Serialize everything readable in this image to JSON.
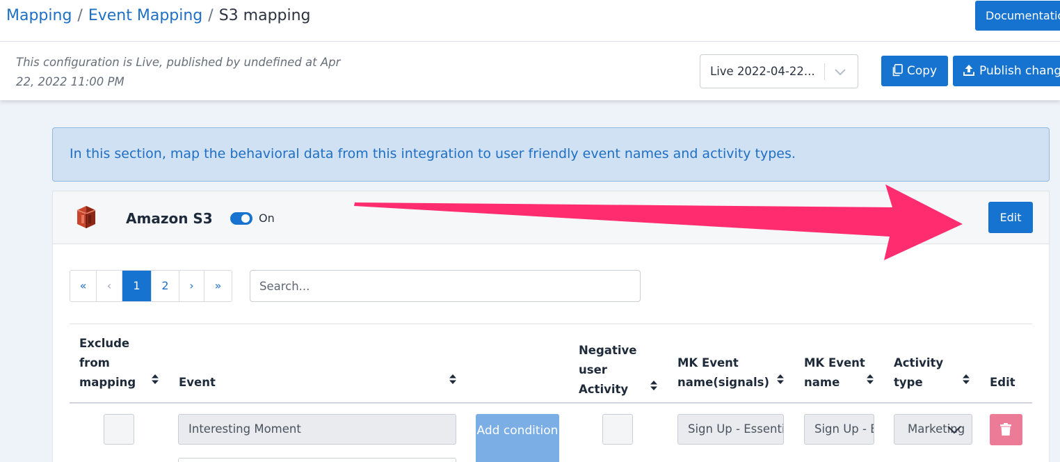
{
  "breadcrumb": {
    "items": [
      "Mapping",
      "Event Mapping"
    ],
    "separator": "/",
    "current": "S3 mapping"
  },
  "header": {
    "documentation_label": "Documentation"
  },
  "status": {
    "note": "This configuration is Live, published by undefined at Apr 22, 2022 11:00 PM",
    "version_selected": "Live 2022-04-22...",
    "copy_label": "Copy",
    "publish_label": "Publish changes"
  },
  "banner": {
    "text": "In this section, map the behavioral data from this integration to user friendly event names and activity types."
  },
  "integration": {
    "name": "Amazon S3",
    "toggle_on": true,
    "toggle_label": "On",
    "edit_label": "Edit"
  },
  "pagination": {
    "first": "«",
    "prev": "‹",
    "pages": [
      "1",
      "2"
    ],
    "active_page": "1",
    "next": "›",
    "last": "»"
  },
  "search": {
    "placeholder": "Search...",
    "value": ""
  },
  "table": {
    "headers": {
      "exclude": "Exclude from mapping",
      "event": "Event",
      "negative": "Negative user Activity",
      "mk_signals": "MK Event name(signals)",
      "mk_name": "MK Event name",
      "activity": "Activity type",
      "edit": "Edit"
    },
    "rows": [
      {
        "exclude_checked": false,
        "event": "Interesting Moment",
        "add_condition_label": "Add condition",
        "negative_checked": false,
        "mk_signals": "Sign Up - Essential",
        "mk_name": "Sign Up - Essential",
        "activity_type": "Marketing"
      }
    ]
  },
  "colors": {
    "primary": "#1773d0",
    "link": "#1f6fc4",
    "banner_bg": "#cfe1f3",
    "delete": "#ec7b98",
    "annotation_arrow": "#ff2d6f"
  },
  "icons": {
    "logo": "amazon-s3-logo",
    "copy": "copy-icon",
    "publish": "upload-icon",
    "sort": "sort-icon",
    "delete": "trash-icon",
    "select": "chevron-down-icon"
  }
}
